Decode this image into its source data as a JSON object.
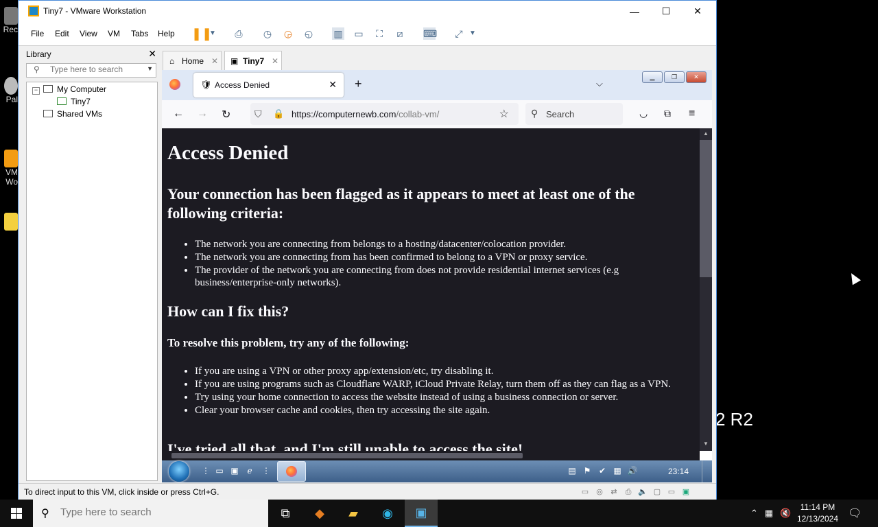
{
  "host_desktop": {
    "icon_labels": [
      "Rec",
      "Pal",
      "VM Wo",
      ""
    ],
    "right_text": "2 R2"
  },
  "vmware": {
    "title": "Tiny7 - VMware Workstation",
    "window_buttons": {
      "minimize": "—",
      "maximize": "☐",
      "close": "✕"
    },
    "menu": [
      "File",
      "Edit",
      "View",
      "VM",
      "Tabs",
      "Help"
    ],
    "library": {
      "title": "Library",
      "search_placeholder": "Type here to search",
      "tree": [
        "My Computer",
        "Tiny7",
        "Shared VMs"
      ]
    },
    "tabs": [
      {
        "label": "Home"
      },
      {
        "label": "Tiny7"
      }
    ],
    "status_message": "To direct input to this VM, click inside or press Ctrl+G."
  },
  "firefox": {
    "tab_title": "Access Denied",
    "url_host": "https://computernewb.com",
    "url_path": "/collab-vm/",
    "search_label": "Search"
  },
  "page": {
    "heading": "Access Denied",
    "subheading": "Your connection has been flagged as it appears to meet at least one of the following criteria:",
    "criteria": [
      "The network you are connecting from belongs to a hosting/datacenter/colocation provider.",
      "The network you are connecting from has been confirmed to belong to a VPN or proxy service.",
      "The provider of the network you are connecting from does not provide residential internet services (e.g business/enterprise-only networks)."
    ],
    "fix_heading": "How can I fix this?",
    "resolve_heading": "To resolve this problem, try any of the following:",
    "fixes": [
      "If you are using a VPN or other proxy app/extension/etc, try disabling it.",
      "If you are using programs such as Cloudflare WARP, iCloud Private Relay, turn them off as they can flag as a VPN.",
      "Try using your home connection to access the website instead of using a business connection or server.",
      "Clear your browser cache and cookies, then try accessing the site again."
    ],
    "cut_heading": "I've tried all that, and I'm still unable to access the site!"
  },
  "guest_taskbar": {
    "clock": "23:14"
  },
  "host_taskbar": {
    "search_placeholder": "Type here to search",
    "time": "11:14 PM",
    "date": "12/13/2024"
  }
}
